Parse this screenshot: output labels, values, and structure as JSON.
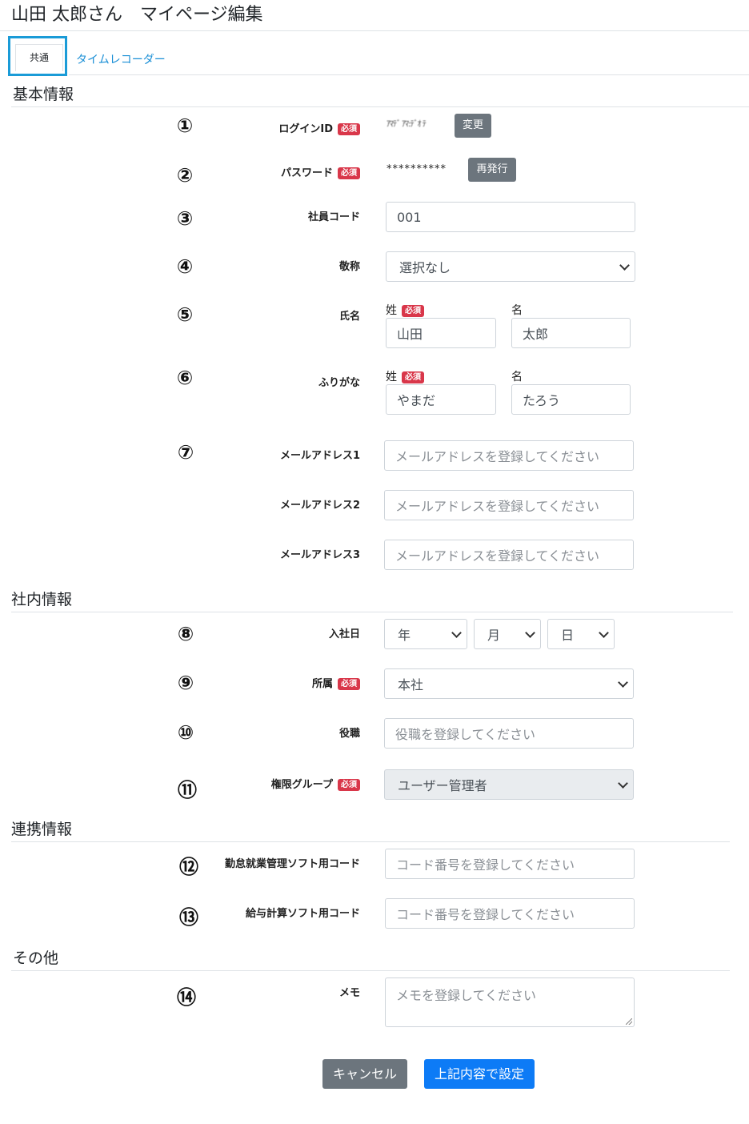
{
  "page": {
    "title": "山田 太郎さん　マイページ編集"
  },
  "tabs": [
    {
      "label": "共通",
      "active": true
    },
    {
      "label": "タイムレコーダー",
      "active": false
    }
  ],
  "required_badge": "必須",
  "sections": {
    "basic": "基本情報",
    "company": "社内情報",
    "integration": "連携情報",
    "other": "その他"
  },
  "markers": [
    "①",
    "②",
    "③",
    "④",
    "⑤",
    "⑥",
    "⑦",
    "⑧",
    "⑨",
    "⑩",
    "⑪",
    "⑫",
    "⑬",
    "⑭"
  ],
  "fields": {
    "login_id": {
      "label": "ログインID",
      "value": "ｱﾏﾃﾞ ｱﾏ:ﾃﾞｵ ﾃ",
      "button": "変更"
    },
    "password": {
      "label": "パスワード",
      "value": "**********",
      "button": "再発行"
    },
    "employee_code": {
      "label": "社員コード",
      "value": "001"
    },
    "honorific": {
      "label": "敬称",
      "value": "選択なし"
    },
    "name": {
      "label": "氏名",
      "last_label": "姓",
      "first_label": "名",
      "last_value": "山田",
      "first_value": "太郎"
    },
    "kana": {
      "label": "ふりがな",
      "last_label": "姓",
      "first_label": "名",
      "last_value": "やまだ",
      "first_value": "たろう"
    },
    "email1": {
      "label": "メールアドレス1",
      "placeholder": "メールアドレスを登録してください"
    },
    "email2": {
      "label": "メールアドレス2",
      "placeholder": "メールアドレスを登録してください"
    },
    "email3": {
      "label": "メールアドレス3",
      "placeholder": "メールアドレスを登録してください"
    },
    "join_date": {
      "label": "入社日",
      "year": "年",
      "month": "月",
      "day": "日"
    },
    "department": {
      "label": "所属",
      "value": "本社"
    },
    "position": {
      "label": "役職",
      "placeholder": "役職を登録してください"
    },
    "permission_group": {
      "label": "権限グループ",
      "value": "ユーザー管理者"
    },
    "attendance_code": {
      "label": "勤怠就業管理ソフト用コード",
      "placeholder": "コード番号を登録してください"
    },
    "payroll_code": {
      "label": "給与計算ソフト用コード",
      "placeholder": "コード番号を登録してください"
    },
    "memo": {
      "label": "メモ",
      "placeholder": "メモを登録してください"
    }
  },
  "buttons": {
    "cancel": "キャンセル",
    "submit": "上記内容で設定"
  }
}
